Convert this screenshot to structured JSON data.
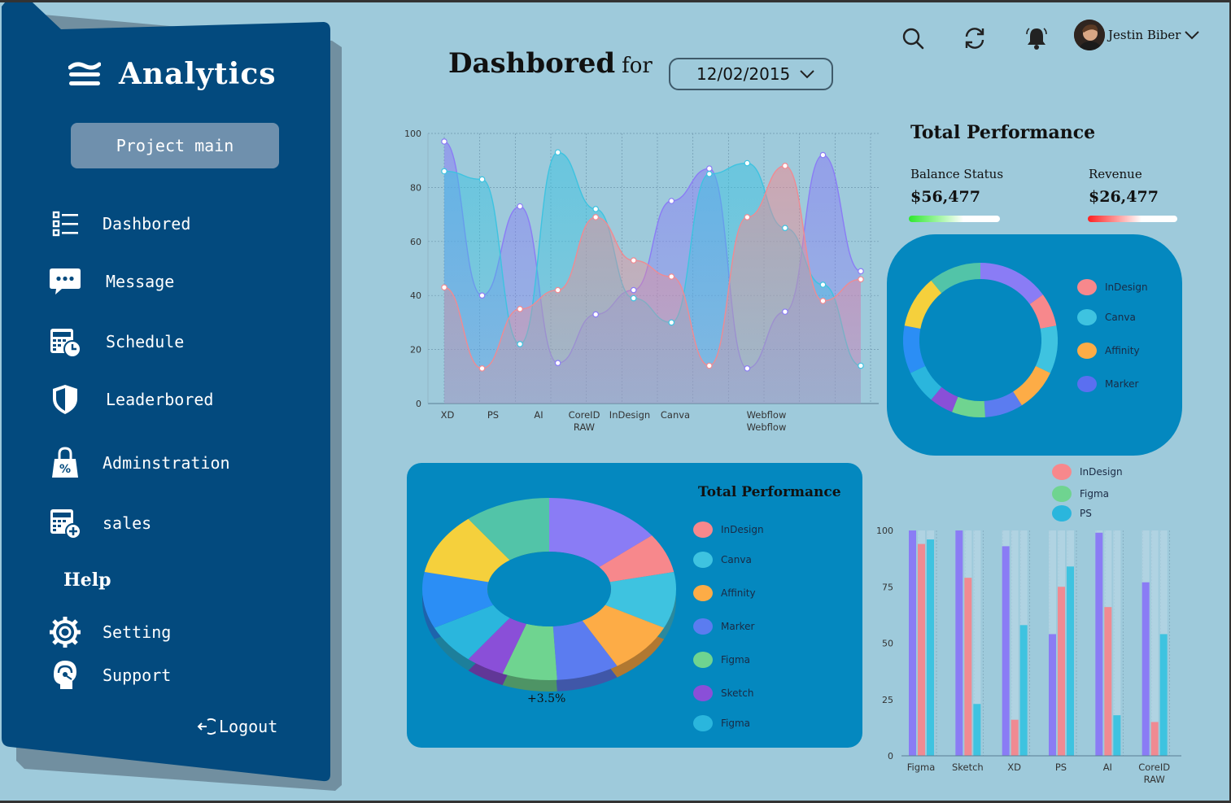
{
  "sidebar": {
    "brand": "Analytics",
    "project_button": "Project main",
    "items": [
      {
        "label": "Dashbored",
        "icon": "list-icon"
      },
      {
        "label": "Message",
        "icon": "chat-icon"
      },
      {
        "label": "Schedule",
        "icon": "calendar-clock-icon"
      },
      {
        "label": "Leaderbored",
        "icon": "shield-icon"
      },
      {
        "label": "Adminstration",
        "icon": "lock-bag-icon"
      },
      {
        "label": "sales",
        "icon": "calculator-plus-icon"
      }
    ],
    "help_label": "Help",
    "help_items": [
      {
        "label": "Setting",
        "icon": "gear-icon"
      },
      {
        "label": "Support",
        "icon": "support-icon"
      }
    ],
    "logout": "Logout"
  },
  "header": {
    "title": "Dashbored",
    "title_suffix": "for",
    "date": "12/02/2015",
    "user_name": "Jestin Biber"
  },
  "performance": {
    "title": "Total Performance",
    "balance_label": "Balance Status",
    "balance_value": "$56,477",
    "revenue_label": "Revenue",
    "revenue_value": "$26,477",
    "ring_legend": [
      {
        "name": "InDesign",
        "color": "#f7888c"
      },
      {
        "name": "Canva",
        "color": "#3ec3e0"
      },
      {
        "name": "Affinity",
        "color": "#fdac46"
      },
      {
        "name": "Marker",
        "color": "#5b6ff0"
      }
    ]
  },
  "pie_panel": {
    "title": "Total Performance",
    "caption": "+3.5%",
    "legend": [
      {
        "name": "InDesign",
        "color": "#f7888c"
      },
      {
        "name": "Canva",
        "color": "#3ec3e0"
      },
      {
        "name": "Affinity",
        "color": "#fdac46"
      },
      {
        "name": "Marker",
        "color": "#5b7cf0"
      },
      {
        "name": "Figma",
        "color": "#6fd490"
      },
      {
        "name": "Sketch",
        "color": "#8a4fd8"
      },
      {
        "name": "Figma",
        "color": "#2ab6dd"
      }
    ]
  },
  "bar_legend": [
    {
      "name": "InDesign",
      "color": "#f7888c"
    },
    {
      "name": "Figma",
      "color": "#6fd490"
    },
    {
      "name": "PS",
      "color": "#2ab6dd"
    }
  ],
  "chart_data": [
    {
      "type": "area",
      "x": [
        "XD",
        "PS",
        "AI",
        "CoreID RAW",
        "InDesign",
        "Canva",
        "",
        "Webflow Webflow",
        "",
        ""
      ],
      "ylim": [
        0,
        100
      ],
      "yticks": [
        0,
        20,
        40,
        60,
        80,
        100
      ],
      "series": [
        {
          "color": "#8a7cf5",
          "values": [
            97,
            40,
            73,
            15,
            33,
            42,
            75,
            87,
            13,
            34,
            92,
            49
          ]
        },
        {
          "color": "#3ec3e0",
          "values": [
            86,
            83,
            22,
            93,
            72,
            39,
            30,
            85,
            89,
            65,
            44,
            14
          ]
        },
        {
          "color": "#f08a92",
          "values": [
            43,
            13,
            35,
            42,
            69,
            53,
            47,
            14,
            69,
            88,
            38,
            46
          ]
        }
      ]
    },
    {
      "type": "pie",
      "slices": [
        {
          "color": "#8a7cf5",
          "value": 15
        },
        {
          "color": "#f7888c",
          "value": 7
        },
        {
          "color": "#3ec3e0",
          "value": 10
        },
        {
          "color": "#fdac46",
          "value": 9
        },
        {
          "color": "#5b7cf0",
          "value": 8
        },
        {
          "color": "#6fd490",
          "value": 7
        },
        {
          "color": "#8a4fd8",
          "value": 5
        },
        {
          "color": "#2ab6dd",
          "value": 7
        },
        {
          "color": "#2b8ef5",
          "value": 10
        },
        {
          "color": "#f5d03c",
          "value": 11
        },
        {
          "color": "#52c4a8",
          "value": 11
        }
      ]
    },
    {
      "type": "bar",
      "categories": [
        "Figma",
        "Sketch",
        "XD",
        "PS",
        "AI",
        "CoreID RAW"
      ],
      "ylim": [
        0,
        100
      ],
      "yticks": [
        0,
        25,
        50,
        75,
        100
      ],
      "series": [
        {
          "color": "#8a7cf5",
          "values": [
            100,
            100,
            93,
            54,
            99,
            77
          ]
        },
        {
          "color": "#f08a92",
          "values": [
            94,
            79,
            16,
            75,
            66,
            15
          ]
        },
        {
          "color": "#3ec3e0",
          "values": [
            96,
            23,
            58,
            84,
            18,
            54
          ]
        }
      ]
    }
  ],
  "colors": {
    "sidebar": "#034a7e",
    "background": "#9ecadb",
    "panel": "#0488bf"
  }
}
